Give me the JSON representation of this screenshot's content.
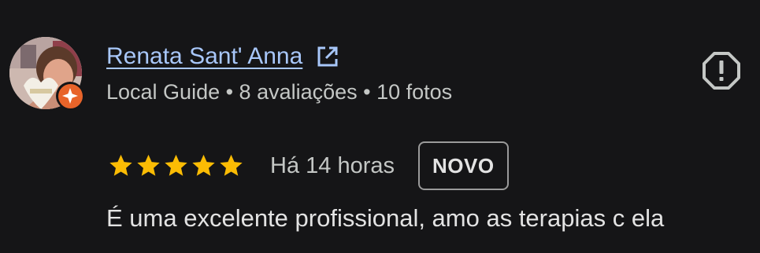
{
  "review": {
    "reviewer_name": "Renata Sant' Anna",
    "meta": "Local Guide • 8 avaliações • 10 fotos",
    "rating": 5,
    "time": "Há 14 horas",
    "badge": "NOVO",
    "text": "É uma excelente profissional, amo as terapias c ela"
  },
  "icons": {
    "open": "open-in-new-icon",
    "report": "report-flag-icon",
    "guide": "local-guide-star-icon",
    "star": "star-icon"
  },
  "colors": {
    "background": "#151517",
    "link": "#a8c7fa",
    "star": "#fbbc04",
    "guide_badge": "#e8642a"
  }
}
